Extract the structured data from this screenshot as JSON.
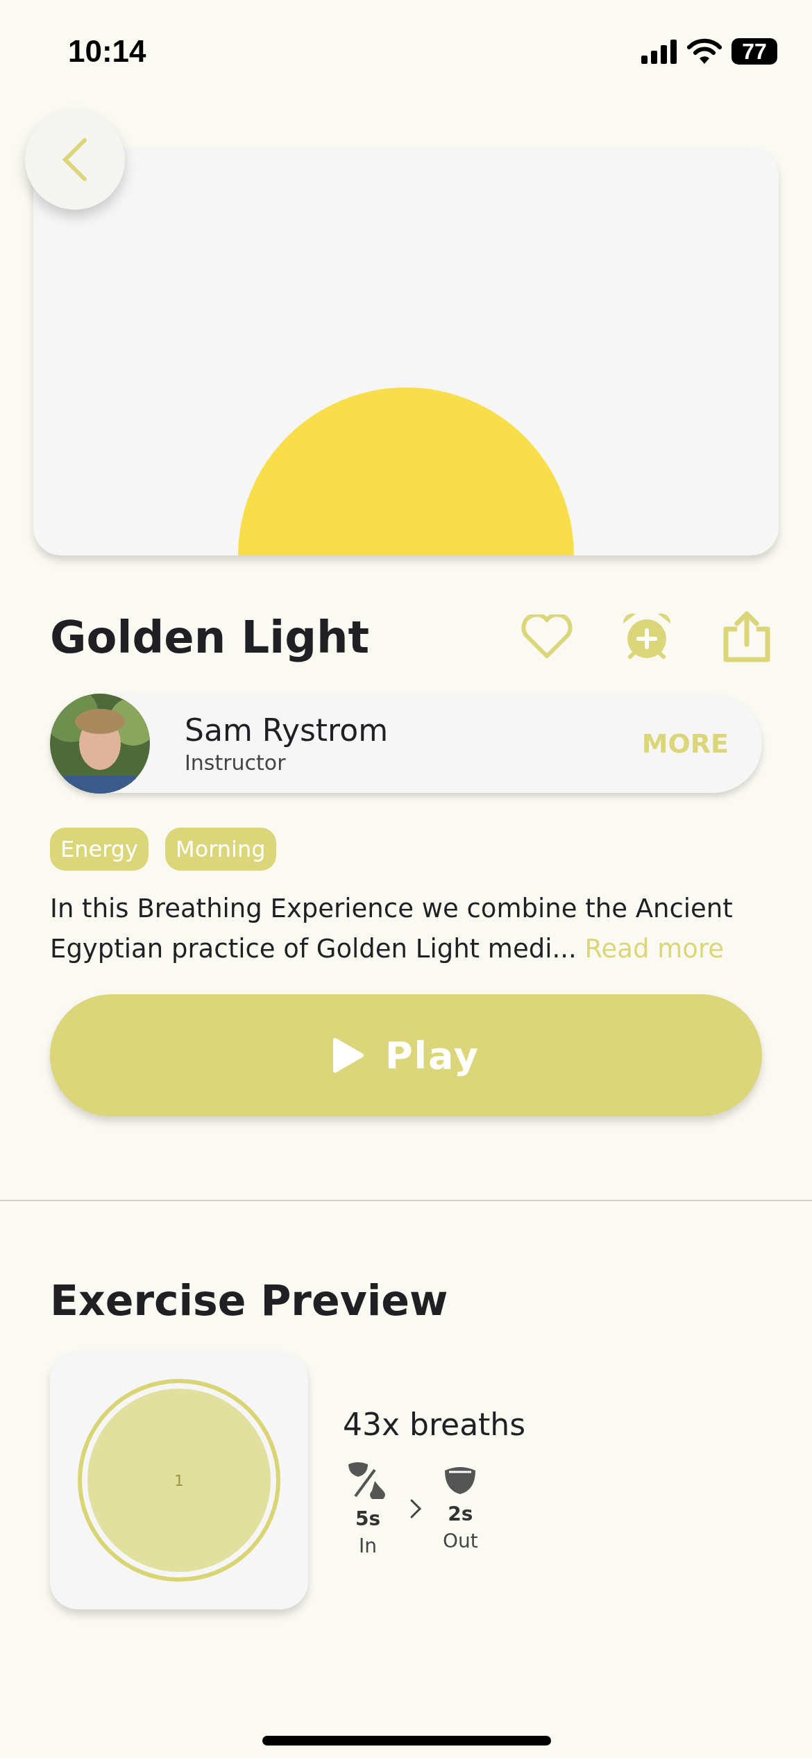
{
  "status_bar": {
    "time": "10:14",
    "battery": "77"
  },
  "session": {
    "title": "Golden Light",
    "instructor": {
      "name": "Sam Rystrom",
      "role": "Instructor",
      "more": "MORE"
    },
    "tags": [
      "Energy",
      "Morning"
    ],
    "description": "In this Breathing Experience we combine the Ancient Egyptian practice of Golden Light medi...",
    "read_more": "Read more",
    "play": "Play"
  },
  "preview": {
    "title": "Exercise Preview",
    "count_label": "1",
    "breaths": "43x breaths",
    "phases": [
      {
        "kind": "in",
        "duration": "5s",
        "label": "In"
      },
      {
        "kind": "out",
        "duration": "2s",
        "label": "Out"
      }
    ]
  }
}
